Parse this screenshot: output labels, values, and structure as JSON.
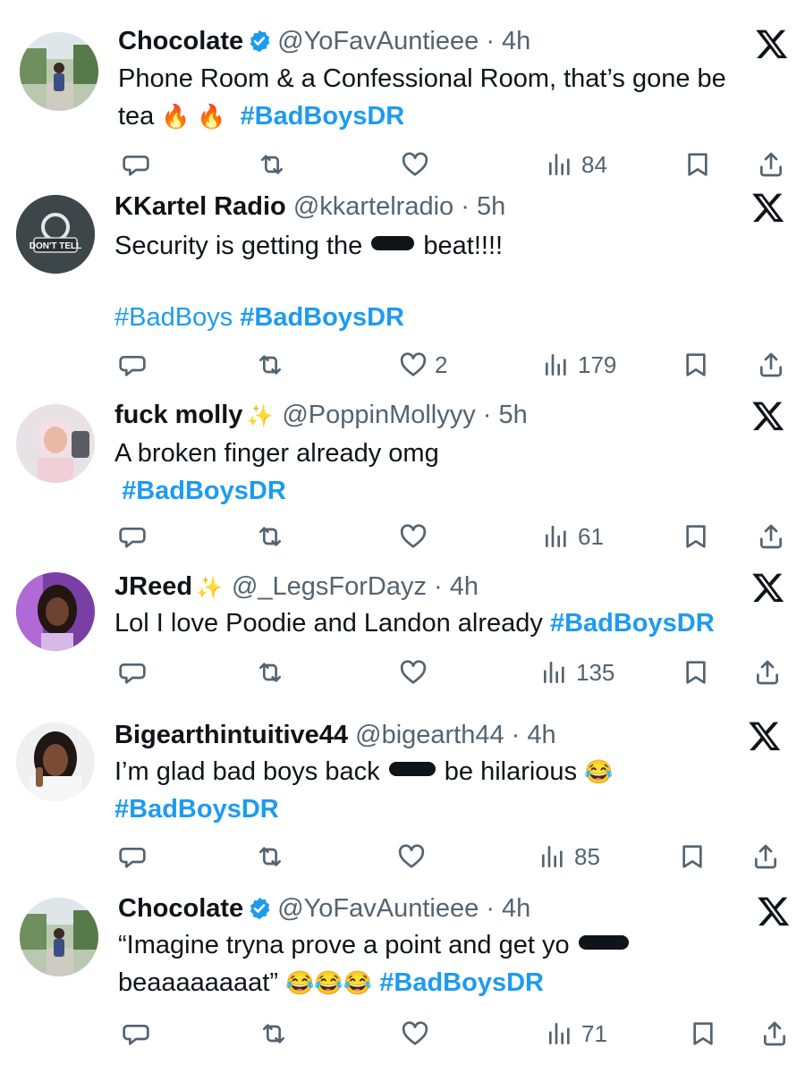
{
  "colors": {
    "link": "#1d9bf0",
    "text": "#0f1419",
    "muted": "#536471",
    "verified": "#1d9bf0"
  },
  "tweets": [
    {
      "name": "Chocolate",
      "verified": true,
      "sparkle": false,
      "handle": "@YoFavAuntieee",
      "time": "4h",
      "line1": "Phone Room & a Confessional Room, that’s gone be",
      "line2_text": "tea",
      "line2_emoji": "🔥 🔥",
      "hashtag": "#BadBoysDR",
      "replies": "",
      "likes": "",
      "views": "84"
    },
    {
      "name": "KKartel Radio",
      "verified": false,
      "sparkle": false,
      "handle": "@kkartelradio",
      "time": "5h",
      "line1_pre": "Security is getting the",
      "line1_post": "beat!!!!",
      "hashtag_light": "#BadBoys",
      "hashtag": "#BadBoysDR",
      "likes": "2",
      "views": "179",
      "avatar_text": "DON'T TELL"
    },
    {
      "name": "fuck molly",
      "verified": false,
      "sparkle": true,
      "handle": "@PoppinMollyyy",
      "time": "5h",
      "line1": "A broken finger already omg",
      "hashtag": "#BadBoysDR",
      "likes": "",
      "views": "61"
    },
    {
      "name": "JReed",
      "verified": false,
      "sparkle": true,
      "handle": "@_LegsForDayz",
      "time": "4h",
      "line1": "Lol I love Poodie and Landon already",
      "hashtag": "#BadBoysDR",
      "likes": "",
      "views": "135"
    },
    {
      "name": "Bigearthintuitive44",
      "verified": false,
      "sparkle": false,
      "handle": "@bigearth44",
      "time": "4h",
      "line1_pre": "I’m glad bad boys back",
      "line1_post": "be hilarious",
      "line1_emoji": "😂",
      "hashtag": "#BadBoysDR",
      "likes": "",
      "views": "85"
    },
    {
      "name": "Chocolate",
      "verified": true,
      "sparkle": false,
      "handle": "@YoFavAuntieee",
      "time": "4h",
      "line1_pre": "“Imagine tryna prove a point and get yo",
      "line2_text": "beaaaaaaaat”",
      "line2_emoji": "😂😂😂",
      "hashtag": "#BadBoysDR",
      "likes": "",
      "views": "71"
    }
  ]
}
